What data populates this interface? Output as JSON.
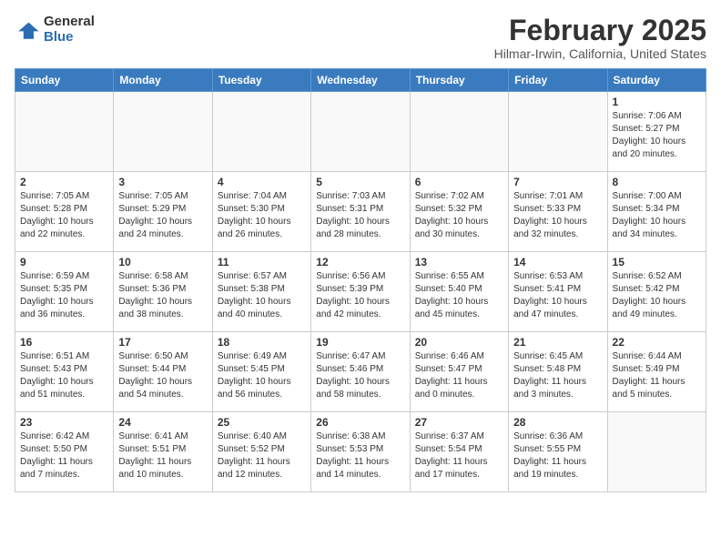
{
  "header": {
    "logo_general": "General",
    "logo_blue": "Blue",
    "month_title": "February 2025",
    "location": "Hilmar-Irwin, California, United States"
  },
  "days_of_week": [
    "Sunday",
    "Monday",
    "Tuesday",
    "Wednesday",
    "Thursday",
    "Friday",
    "Saturday"
  ],
  "weeks": [
    [
      {
        "day": "",
        "info": ""
      },
      {
        "day": "",
        "info": ""
      },
      {
        "day": "",
        "info": ""
      },
      {
        "day": "",
        "info": ""
      },
      {
        "day": "",
        "info": ""
      },
      {
        "day": "",
        "info": ""
      },
      {
        "day": "1",
        "info": "Sunrise: 7:06 AM\nSunset: 5:27 PM\nDaylight: 10 hours\nand 20 minutes."
      }
    ],
    [
      {
        "day": "2",
        "info": "Sunrise: 7:05 AM\nSunset: 5:28 PM\nDaylight: 10 hours\nand 22 minutes."
      },
      {
        "day": "3",
        "info": "Sunrise: 7:05 AM\nSunset: 5:29 PM\nDaylight: 10 hours\nand 24 minutes."
      },
      {
        "day": "4",
        "info": "Sunrise: 7:04 AM\nSunset: 5:30 PM\nDaylight: 10 hours\nand 26 minutes."
      },
      {
        "day": "5",
        "info": "Sunrise: 7:03 AM\nSunset: 5:31 PM\nDaylight: 10 hours\nand 28 minutes."
      },
      {
        "day": "6",
        "info": "Sunrise: 7:02 AM\nSunset: 5:32 PM\nDaylight: 10 hours\nand 30 minutes."
      },
      {
        "day": "7",
        "info": "Sunrise: 7:01 AM\nSunset: 5:33 PM\nDaylight: 10 hours\nand 32 minutes."
      },
      {
        "day": "8",
        "info": "Sunrise: 7:00 AM\nSunset: 5:34 PM\nDaylight: 10 hours\nand 34 minutes."
      }
    ],
    [
      {
        "day": "9",
        "info": "Sunrise: 6:59 AM\nSunset: 5:35 PM\nDaylight: 10 hours\nand 36 minutes."
      },
      {
        "day": "10",
        "info": "Sunrise: 6:58 AM\nSunset: 5:36 PM\nDaylight: 10 hours\nand 38 minutes."
      },
      {
        "day": "11",
        "info": "Sunrise: 6:57 AM\nSunset: 5:38 PM\nDaylight: 10 hours\nand 40 minutes."
      },
      {
        "day": "12",
        "info": "Sunrise: 6:56 AM\nSunset: 5:39 PM\nDaylight: 10 hours\nand 42 minutes."
      },
      {
        "day": "13",
        "info": "Sunrise: 6:55 AM\nSunset: 5:40 PM\nDaylight: 10 hours\nand 45 minutes."
      },
      {
        "day": "14",
        "info": "Sunrise: 6:53 AM\nSunset: 5:41 PM\nDaylight: 10 hours\nand 47 minutes."
      },
      {
        "day": "15",
        "info": "Sunrise: 6:52 AM\nSunset: 5:42 PM\nDaylight: 10 hours\nand 49 minutes."
      }
    ],
    [
      {
        "day": "16",
        "info": "Sunrise: 6:51 AM\nSunset: 5:43 PM\nDaylight: 10 hours\nand 51 minutes."
      },
      {
        "day": "17",
        "info": "Sunrise: 6:50 AM\nSunset: 5:44 PM\nDaylight: 10 hours\nand 54 minutes."
      },
      {
        "day": "18",
        "info": "Sunrise: 6:49 AM\nSunset: 5:45 PM\nDaylight: 10 hours\nand 56 minutes."
      },
      {
        "day": "19",
        "info": "Sunrise: 6:47 AM\nSunset: 5:46 PM\nDaylight: 10 hours\nand 58 minutes."
      },
      {
        "day": "20",
        "info": "Sunrise: 6:46 AM\nSunset: 5:47 PM\nDaylight: 11 hours\nand 0 minutes."
      },
      {
        "day": "21",
        "info": "Sunrise: 6:45 AM\nSunset: 5:48 PM\nDaylight: 11 hours\nand 3 minutes."
      },
      {
        "day": "22",
        "info": "Sunrise: 6:44 AM\nSunset: 5:49 PM\nDaylight: 11 hours\nand 5 minutes."
      }
    ],
    [
      {
        "day": "23",
        "info": "Sunrise: 6:42 AM\nSunset: 5:50 PM\nDaylight: 11 hours\nand 7 minutes."
      },
      {
        "day": "24",
        "info": "Sunrise: 6:41 AM\nSunset: 5:51 PM\nDaylight: 11 hours\nand 10 minutes."
      },
      {
        "day": "25",
        "info": "Sunrise: 6:40 AM\nSunset: 5:52 PM\nDaylight: 11 hours\nand 12 minutes."
      },
      {
        "day": "26",
        "info": "Sunrise: 6:38 AM\nSunset: 5:53 PM\nDaylight: 11 hours\nand 14 minutes."
      },
      {
        "day": "27",
        "info": "Sunrise: 6:37 AM\nSunset: 5:54 PM\nDaylight: 11 hours\nand 17 minutes."
      },
      {
        "day": "28",
        "info": "Sunrise: 6:36 AM\nSunset: 5:55 PM\nDaylight: 11 hours\nand 19 minutes."
      },
      {
        "day": "",
        "info": ""
      }
    ]
  ]
}
